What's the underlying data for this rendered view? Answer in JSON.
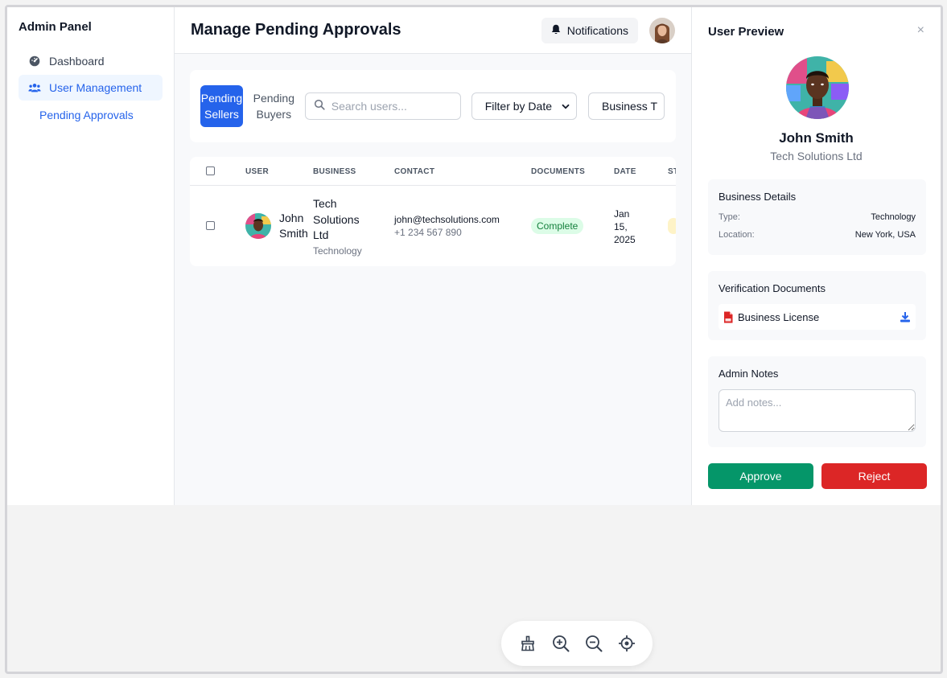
{
  "sidebar": {
    "title": "Admin Panel",
    "items": [
      {
        "label": "Dashboard",
        "icon": "dashboard-icon"
      },
      {
        "label": "User Management",
        "icon": "users-icon"
      }
    ],
    "sub_item": "Pending Approvals"
  },
  "header": {
    "title": "Manage Pending Approvals",
    "notifications_label": "Notifications"
  },
  "filters": {
    "tabs": [
      "Pending Sellers",
      "Pending Buyers"
    ],
    "search_placeholder": "Search users...",
    "date_filter": "Filter by Date",
    "business_filter": "Business T"
  },
  "table": {
    "headers": [
      "USER",
      "BUSINESS",
      "CONTACT",
      "DOCUMENTS",
      "DATE",
      "ST"
    ],
    "rows": [
      {
        "user_first": "John",
        "user_last": "Smith",
        "business_l1": "Tech",
        "business_l2": "Solutions",
        "business_l3": "Ltd",
        "business_type": "Technology",
        "email": "john@techsolutions.com",
        "phone": "+1 234 567 890",
        "documents": "Complete",
        "date_l1": "Jan",
        "date_l2": "15,",
        "date_l3": "2025"
      }
    ]
  },
  "preview": {
    "title": "User Preview",
    "close": "×",
    "name": "John Smith",
    "company": "Tech Solutions Ltd",
    "business_details": {
      "heading": "Business Details",
      "type_label": "Type:",
      "type_value": "Technology",
      "location_label": "Location:",
      "location_value": "New York, USA"
    },
    "documents": {
      "heading": "Verification Documents",
      "file": "Business License"
    },
    "notes": {
      "heading": "Admin Notes",
      "placeholder": "Add notes..."
    },
    "approve": "Approve",
    "reject": "Reject"
  },
  "colors": {
    "primary": "#2563eb",
    "approve": "#059669",
    "reject": "#dc2626",
    "complete_badge_bg": "#dcfce7"
  }
}
